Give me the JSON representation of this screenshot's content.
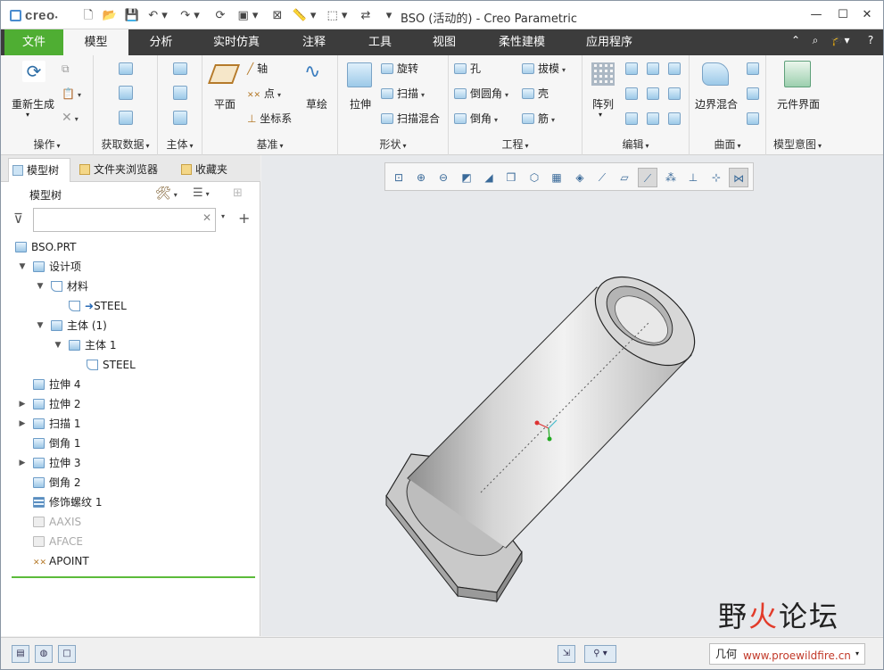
{
  "titlebar": {
    "logo": "creo",
    "window_title": "BSO (活动的) - Creo Parametric",
    "minimize": "—",
    "maximize": "☐",
    "close": "✕"
  },
  "tabs": [
    {
      "label": "文件"
    },
    {
      "label": "模型"
    },
    {
      "label": "分析"
    },
    {
      "label": "实时仿真"
    },
    {
      "label": "注释"
    },
    {
      "label": "工具"
    },
    {
      "label": "视图"
    },
    {
      "label": "柔性建模"
    },
    {
      "label": "应用程序"
    }
  ],
  "ribbon": {
    "operations": {
      "label": "操作",
      "regenerate": "重新生成"
    },
    "get_data": {
      "label": "获取数据"
    },
    "body": {
      "label": "主体"
    },
    "datum": {
      "label": "基准",
      "plane": "平面",
      "axis": "轴",
      "point": "点",
      "csys": "坐标系",
      "sketch": "草绘"
    },
    "shapes": {
      "label": "形状",
      "extrude": "拉伸",
      "revolve": "旋转",
      "sweep": "扫描",
      "swept_blend": "扫描混合"
    },
    "engineering": {
      "label": "工程",
      "hole": "孔",
      "draft": "拔模",
      "round": "倒圆角",
      "shell": "壳",
      "chamfer": "倒角",
      "rib": "筋"
    },
    "editing": {
      "label": "编辑",
      "pattern": "阵列"
    },
    "surfaces": {
      "label": "曲面",
      "boundary_blend": "边界混合"
    },
    "model_intent": {
      "label": "模型意图",
      "component_interface": "元件界面"
    }
  },
  "panel": {
    "tabs": {
      "model_tree": "模型树",
      "folder_browser": "文件夹浏览器",
      "favorites": "收藏夹"
    },
    "header": "模型树",
    "filter_placeholder": "",
    "tree": [
      {
        "label": "BSO.PRT"
      },
      {
        "label": "设计项"
      },
      {
        "label": "材料"
      },
      {
        "label": "STEEL"
      },
      {
        "label": "主体 (1)"
      },
      {
        "label": "主体 1"
      },
      {
        "label": "STEEL"
      },
      {
        "label": "拉伸 4"
      },
      {
        "label": "拉伸 2"
      },
      {
        "label": "扫描 1"
      },
      {
        "label": "倒角 1"
      },
      {
        "label": "拉伸 3"
      },
      {
        "label": "倒角 2"
      },
      {
        "label": "修饰螺纹 1"
      },
      {
        "label": "AAXIS"
      },
      {
        "label": "AFACE"
      },
      {
        "label": "APOINT"
      }
    ]
  },
  "status": {
    "filter_value": "几何"
  },
  "watermark": {
    "text_a": "野",
    "text_b": "火",
    "text_c": "论坛",
    "url": "www.proewildfire.cn"
  }
}
